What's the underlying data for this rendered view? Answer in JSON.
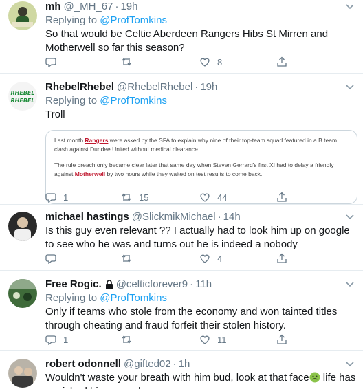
{
  "reply_prefix": "Replying to",
  "tweets": [
    {
      "name": "mh",
      "handle": "@_MH_67",
      "time": "19h",
      "mention": "@ProfTomkins",
      "text": "So that would be Celtic Aberdeen Rangers Hibs St Mirren and Motherwell so far this season?",
      "replies": "",
      "retweets": "",
      "likes": "8"
    },
    {
      "name": "RhebelRhebel",
      "handle": "@RhebelRhebel",
      "time": "19h",
      "mention": "@ProfTomkins",
      "text": "Troll",
      "avatar_text": "RHEBEL",
      "quote": {
        "p1_before": "Last month ",
        "p1_link": "Rangers",
        "p1_after": " were asked by the SFA to explain why nine of their top-team squad featured in a B team clash against Dundee United without medical clearance.",
        "p2_before": "The rule breach only became clear later that same day when Steven Gerrard's first XI had to delay a friendly against ",
        "p2_link": "Motherwell",
        "p2_after": " by two hours while they waited on test results to come back."
      },
      "replies": "1",
      "retweets": "15",
      "likes": "44"
    },
    {
      "name": "michael hastings",
      "handle": "@SlickmikMichael",
      "time": "14h",
      "text": "Is this guy even relevant ?? I actually had to look him up on google to see who he was and turns out he is indeed a nobody",
      "replies": "",
      "retweets": "",
      "likes": "4"
    },
    {
      "name": "Free Rogic.",
      "handle": "@celticforever9",
      "time": "11h",
      "mention": "@ProfTomkins",
      "text": "Only if teams who stole from the economy and won tainted titles through cheating and fraud forfeit their stolen history.",
      "replies": "1",
      "retweets": "",
      "likes": "11"
    },
    {
      "name": "robert odonnell",
      "handle": "@gifted02",
      "time": "1h",
      "text_before": "Wouldn't waste your breath with him bud, look at that face",
      "text_after": " life has punished him enough"
    }
  ],
  "colors": {
    "name": "#14171a",
    "secondary": "#657786",
    "link": "#1da1f2",
    "divider": "#e6ecf0",
    "quote_link": "#c0172e"
  },
  "icons": [
    "reply-icon",
    "retweet-icon",
    "like-icon",
    "share-icon",
    "chevron-down-icon",
    "lock-icon",
    "nauseated-face-emoji"
  ]
}
